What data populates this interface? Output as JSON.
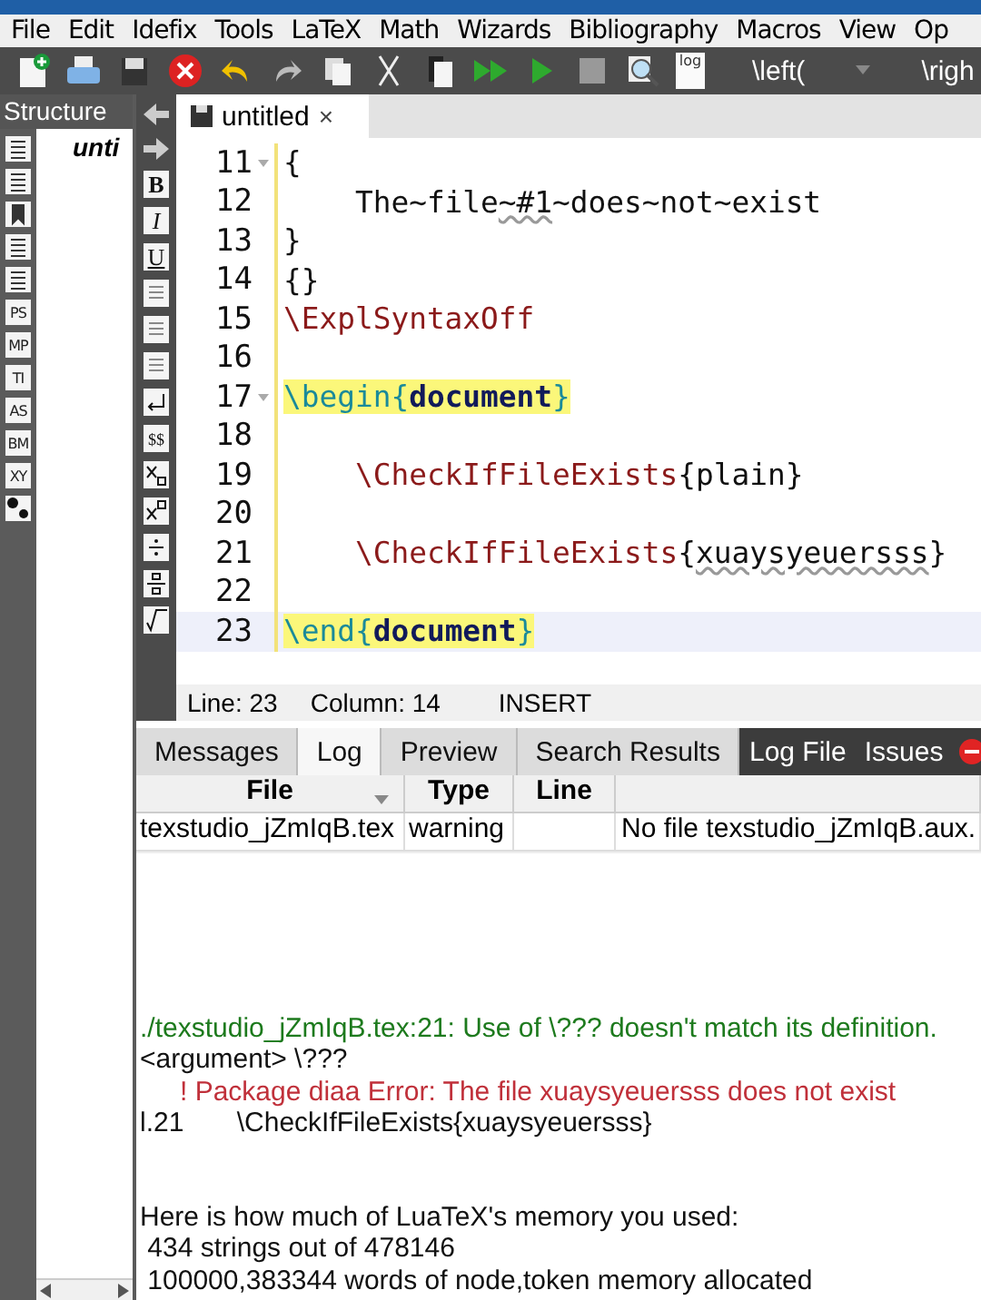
{
  "menu": [
    "File",
    "Edit",
    "Idefix",
    "Tools",
    "LaTeX",
    "Math",
    "Wizards",
    "Bibliography",
    "Macros",
    "View",
    "Op"
  ],
  "toolbar": {
    "log_icon_label": "log",
    "combo": "\\left(",
    "cut_label": "\\righ"
  },
  "structure": {
    "title": "Structure",
    "tools": [
      "PS",
      "MP",
      "TI",
      "AS",
      "BM",
      "XY"
    ],
    "root": "unti"
  },
  "format_tools": {
    "bold": "B",
    "italic": "I",
    "underline": "U",
    "dollars": "$$"
  },
  "editor": {
    "tab": {
      "title": "untitled",
      "close": "×"
    },
    "lines": [
      {
        "number": "11",
        "fold": true,
        "current": false,
        "segments": [
          {
            "text": "{",
            "kind": "plain"
          }
        ]
      },
      {
        "number": "12",
        "fold": false,
        "current": false,
        "segments": [
          {
            "text": "    The~file",
            "kind": "plain"
          },
          {
            "text": "~#1",
            "kind": "misspelled"
          },
          {
            "text": "~does~not~exist",
            "kind": "plain"
          }
        ]
      },
      {
        "number": "13",
        "fold": false,
        "current": false,
        "segments": [
          {
            "text": "}",
            "kind": "plain"
          }
        ]
      },
      {
        "number": "14",
        "fold": false,
        "current": false,
        "segments": [
          {
            "text": "{}",
            "kind": "plain"
          }
        ]
      },
      {
        "number": "15",
        "fold": false,
        "current": false,
        "segments": [
          {
            "text": "\\ExplSyntaxOff",
            "kind": "command"
          }
        ]
      },
      {
        "number": "16",
        "fold": false,
        "current": false
      },
      {
        "number": "17",
        "fold": true,
        "current": false,
        "segments": [
          {
            "text": "\\begin{",
            "kind": "env-matched"
          },
          {
            "text": "document",
            "kind": "env-name-matched"
          },
          {
            "text": "}",
            "kind": "env-matched"
          }
        ]
      },
      {
        "number": "18",
        "fold": false,
        "current": false
      },
      {
        "number": "19",
        "fold": false,
        "current": false,
        "segments": [
          {
            "text": "    \\CheckIfFileExists",
            "kind": "command"
          },
          {
            "text": "{plain}",
            "kind": "plain"
          }
        ]
      },
      {
        "number": "20",
        "fold": false,
        "current": false
      },
      {
        "number": "21",
        "fold": false,
        "current": false,
        "segments": [
          {
            "text": "    \\CheckIfFileExists",
            "kind": "command"
          },
          {
            "text": "{",
            "kind": "plain"
          },
          {
            "text": "xuaysyeuersss",
            "kind": "misspelled"
          },
          {
            "text": "}",
            "kind": "plain"
          }
        ]
      },
      {
        "number": "22",
        "fold": false,
        "current": false
      },
      {
        "number": "23",
        "fold": false,
        "current": true,
        "segments": [
          {
            "text": "\\end{",
            "kind": "env-matched"
          },
          {
            "text": "document",
            "kind": "env-name-matched"
          },
          {
            "text": "}",
            "kind": "env-matched"
          }
        ]
      }
    ],
    "status": {
      "line": "Line: 23",
      "column": "Column: 14",
      "mode": "INSERT"
    }
  },
  "bottom_tabs": [
    {
      "label": "Messages",
      "kind": "tab",
      "selected": false
    },
    {
      "label": "Log",
      "kind": "tab",
      "selected": true
    },
    {
      "label": "Preview",
      "kind": "tab",
      "selected": false
    },
    {
      "label": "Search Results",
      "kind": "tab",
      "selected": false
    },
    {
      "label": "Log File",
      "kind": "button"
    },
    {
      "label": "Issues",
      "kind": "button"
    }
  ],
  "log_table": {
    "columns": [
      "File",
      "Type",
      "Line"
    ],
    "rows": [
      {
        "file": "texstudio_jZmIqB.tex",
        "type": "warning",
        "message": "No file texstudio_jZmIqB.aux."
      }
    ]
  },
  "log_lines": [
    {
      "text": "./texstudio_jZmIqB.tex:21: Use of \\??? doesn't match its definition.",
      "kind": "warning"
    },
    {
      "text": "<argument> \\???",
      "kind": "plain"
    },
    {
      "text": "! Package diaa Error: The file xuaysyeuersss does not exist",
      "kind": "error"
    },
    {
      "text": "l.21       \\CheckIfFileExists{xuaysyeuersss}",
      "kind": "plain"
    },
    {
      "kind": "blank"
    },
    {
      "kind": "blank"
    },
    {
      "text": "Here is how much of LuaTeX's memory you used:",
      "kind": "plain"
    },
    {
      "text": " 434 strings out of 478146",
      "kind": "plain"
    },
    {
      "text": " 100000,383344 words of node,token memory allocated",
      "kind": "plain"
    }
  ]
}
